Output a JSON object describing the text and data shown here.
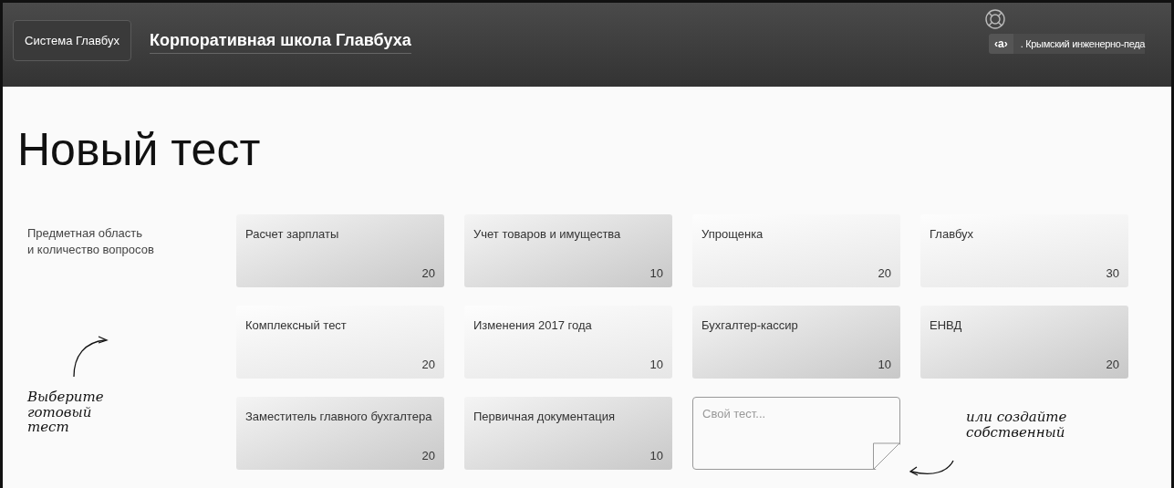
{
  "header": {
    "system_button": "Система Главбух",
    "title": "Корпоративная школа Главбуха",
    "user_badge": "‹а›",
    "organization": ". Крымский инженерно-педа"
  },
  "page_title": "Новый тест",
  "subject_label": "Предметная область\nи количество вопросов",
  "hint_left": "Выберите\nготовый\nтест",
  "hint_right": "или создайте\nсобственный",
  "tests": [
    {
      "name": "Расчет зарплаты",
      "count": "20",
      "selected": true
    },
    {
      "name": "Учет товаров и имущества",
      "count": "10",
      "selected": true
    },
    {
      "name": "Упрощенка",
      "count": "20",
      "selected": false
    },
    {
      "name": "Главбух",
      "count": "30",
      "selected": false
    },
    {
      "name": "Комплексный тест",
      "count": "20",
      "selected": false
    },
    {
      "name": "Изменения 2017 года",
      "count": "10",
      "selected": false
    },
    {
      "name": "Бухгалтер-кассир",
      "count": "10",
      "selected": true
    },
    {
      "name": "ЕНВД",
      "count": "20",
      "selected": true
    },
    {
      "name": "Заместитель главного бухгалтера",
      "count": "20",
      "selected": true
    },
    {
      "name": "Первичная документация",
      "count": "10",
      "selected": true
    }
  ],
  "custom_test": {
    "placeholder": "Свой тест..."
  }
}
